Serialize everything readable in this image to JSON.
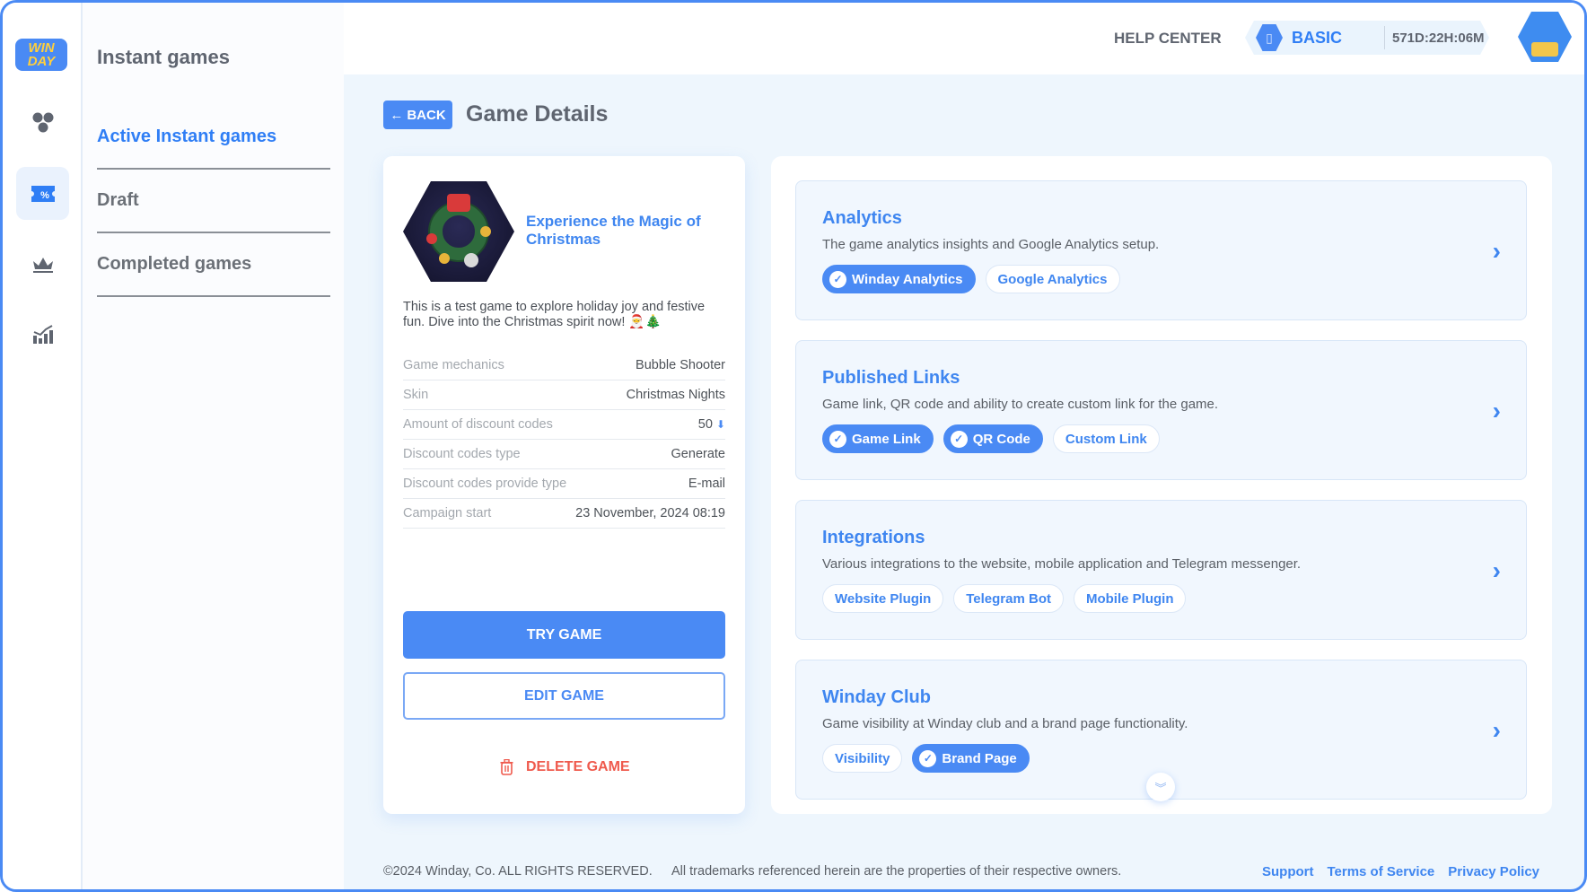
{
  "app": {
    "logo_text": "WIN DAY"
  },
  "rail": {
    "items": [
      {
        "name": "games-hex-icon",
        "active": false
      },
      {
        "name": "discount-ticket-icon",
        "active": true
      },
      {
        "name": "crown-icon",
        "active": false
      },
      {
        "name": "analytics-chart-icon",
        "active": false
      }
    ]
  },
  "subnav": {
    "title": "Instant games",
    "items": [
      {
        "label": "Active Instant games",
        "active": true
      },
      {
        "label": "Draft",
        "active": false
      },
      {
        "label": "Completed games",
        "active": false
      }
    ]
  },
  "header": {
    "help_label": "HELP CENTER",
    "plan_name": "BASIC",
    "plan_timer": "571D:22H:06M"
  },
  "page": {
    "back_label": "BACK",
    "title": "Game Details"
  },
  "game": {
    "name": "Experience the Magic of Christmas",
    "description": "This is a test game to explore holiday joy and festive fun. Dive into the Christmas spirit now! 🎅🎄",
    "details": [
      {
        "key": "Game mechanics",
        "value": "Bubble Shooter"
      },
      {
        "key": "Skin",
        "value": "Christmas Nights"
      },
      {
        "key": "Amount of discount codes",
        "value": "50"
      },
      {
        "key": "Discount codes type",
        "value": "Generate"
      },
      {
        "key": "Discount codes provide type",
        "value": "E-mail"
      },
      {
        "key": "Campaign start",
        "value": "23 November, 2024 08:19"
      }
    ],
    "try_label": "TRY GAME",
    "edit_label": "EDIT GAME",
    "delete_label": "DELETE GAME"
  },
  "sections": [
    {
      "title": "Analytics",
      "desc": "The game analytics insights and Google Analytics setup.",
      "chips": [
        {
          "label": "Winday Analytics",
          "on": true
        },
        {
          "label": "Google Analytics",
          "on": false
        }
      ]
    },
    {
      "title": "Published Links",
      "desc": "Game link, QR code and ability to create custom link for the game.",
      "chips": [
        {
          "label": "Game Link",
          "on": true
        },
        {
          "label": "QR Code",
          "on": true
        },
        {
          "label": "Custom Link",
          "on": false
        }
      ]
    },
    {
      "title": "Integrations",
      "desc": "Various integrations to the website, mobile application and Telegram messenger.",
      "chips": [
        {
          "label": "Website Plugin",
          "on": false
        },
        {
          "label": "Telegram Bot",
          "on": false
        },
        {
          "label": "Mobile Plugin",
          "on": false
        }
      ]
    },
    {
      "title": "Winday Club",
      "desc": "Game visibility at Winday club and a brand page functionality.",
      "chips": [
        {
          "label": "Visibility",
          "on": false
        },
        {
          "label": "Brand Page",
          "on": true
        }
      ]
    }
  ],
  "footer": {
    "copyright": "©2024 Winday, Co. ALL RIGHTS RESERVED.",
    "trademark": "All trademarks referenced herein are the properties of their respective owners.",
    "links": [
      "Support",
      "Terms of Service",
      "Privacy Policy"
    ]
  },
  "colors": {
    "accent": "#4a8af4",
    "danger": "#ef5a4d",
    "text": "#5f6570"
  }
}
